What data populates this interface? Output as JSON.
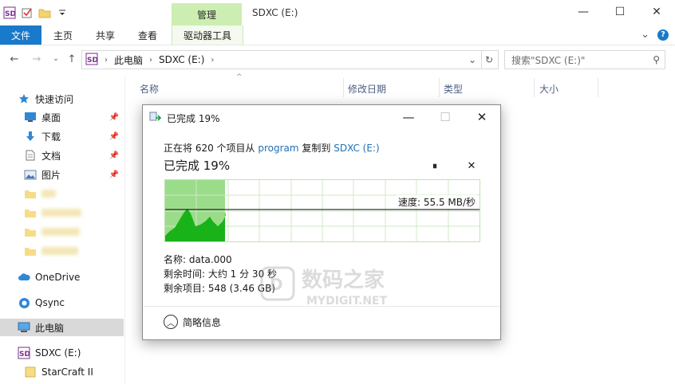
{
  "window": {
    "title": "SDXC (E:)",
    "context_tab": "管理",
    "minimize": "—",
    "maximize": "☐",
    "close": "✕"
  },
  "ribbon": {
    "file": "文件",
    "tabs": [
      "主页",
      "共享",
      "查看"
    ],
    "drive_tools": "驱动器工具",
    "expand": "⌄",
    "help": "?"
  },
  "address": {
    "segments": [
      "此电脑",
      "SDXC (E:)"
    ],
    "sep": "›",
    "dropdown": "⌄",
    "refresh": "↻",
    "search_placeholder": "搜索\"SDXC (E:)\"",
    "search_icon": "⚲"
  },
  "columns": [
    "名称",
    "修改日期",
    "类型",
    "大小"
  ],
  "sidebar": {
    "quick_access": "快速访问",
    "pinned": [
      "桌面",
      "下载",
      "文档",
      "图片"
    ],
    "onedrive": "OneDrive",
    "qsync": "Qsync",
    "this_pc": "此电脑",
    "drive": "SDXC (E:)",
    "starcraft": "StarCraft II"
  },
  "dialog": {
    "title": "已完成 19%",
    "line_prefix": "正在将 620 个项目从 ",
    "source": "program",
    "line_mid": " 复制到 ",
    "dest": "SDXC (E:)",
    "status": "已完成 19%",
    "pause": "⏸",
    "stop": "✕",
    "speed": "速度: 55.5 MB/秒",
    "name_line": "名称: data.000",
    "time_line": "剩余时间: 大约 1 分 30 秒",
    "items_line": "剩余项目: 548 (3.46 GB)",
    "collapse": "简略信息",
    "min": "—",
    "max": "☐",
    "close": "✕"
  },
  "progress": {
    "fraction": 0.19
  },
  "watermark": {
    "cn": "数码之家",
    "en": "MYDIGIT.NET"
  },
  "colors": {
    "accent": "#1979ca",
    "context": "#cdeeb2",
    "graph_fill": "#19b219",
    "graph_bg": "#9bdc8b",
    "link": "#1f6fb5"
  }
}
